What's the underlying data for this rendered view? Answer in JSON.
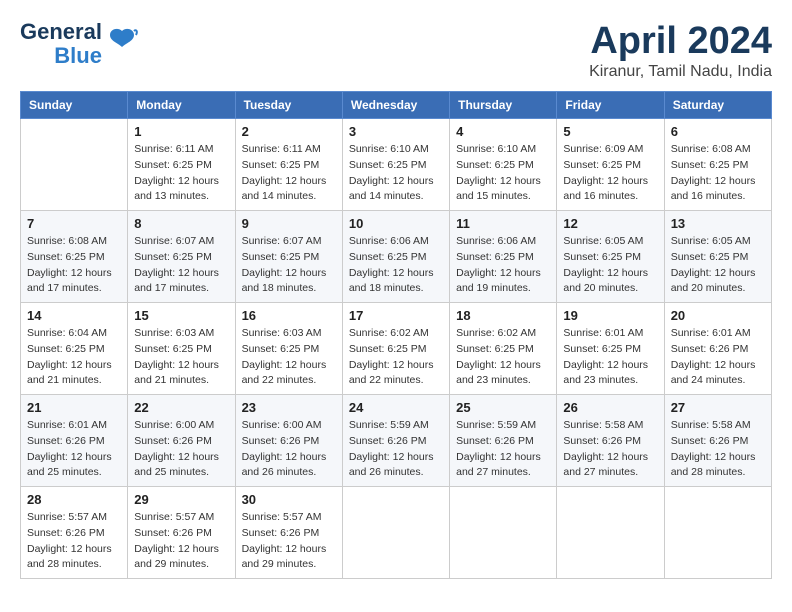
{
  "logo": {
    "line1": "General",
    "line2": "Blue"
  },
  "header": {
    "month": "April 2024",
    "location": "Kiranur, Tamil Nadu, India"
  },
  "weekdays": [
    "Sunday",
    "Monday",
    "Tuesday",
    "Wednesday",
    "Thursday",
    "Friday",
    "Saturday"
  ],
  "weeks": [
    [
      {
        "day": "",
        "info": ""
      },
      {
        "day": "1",
        "info": "Sunrise: 6:11 AM\nSunset: 6:25 PM\nDaylight: 12 hours\nand 13 minutes."
      },
      {
        "day": "2",
        "info": "Sunrise: 6:11 AM\nSunset: 6:25 PM\nDaylight: 12 hours\nand 14 minutes."
      },
      {
        "day": "3",
        "info": "Sunrise: 6:10 AM\nSunset: 6:25 PM\nDaylight: 12 hours\nand 14 minutes."
      },
      {
        "day": "4",
        "info": "Sunrise: 6:10 AM\nSunset: 6:25 PM\nDaylight: 12 hours\nand 15 minutes."
      },
      {
        "day": "5",
        "info": "Sunrise: 6:09 AM\nSunset: 6:25 PM\nDaylight: 12 hours\nand 16 minutes."
      },
      {
        "day": "6",
        "info": "Sunrise: 6:08 AM\nSunset: 6:25 PM\nDaylight: 12 hours\nand 16 minutes."
      }
    ],
    [
      {
        "day": "7",
        "info": "Sunrise: 6:08 AM\nSunset: 6:25 PM\nDaylight: 12 hours\nand 17 minutes."
      },
      {
        "day": "8",
        "info": "Sunrise: 6:07 AM\nSunset: 6:25 PM\nDaylight: 12 hours\nand 17 minutes."
      },
      {
        "day": "9",
        "info": "Sunrise: 6:07 AM\nSunset: 6:25 PM\nDaylight: 12 hours\nand 18 minutes."
      },
      {
        "day": "10",
        "info": "Sunrise: 6:06 AM\nSunset: 6:25 PM\nDaylight: 12 hours\nand 18 minutes."
      },
      {
        "day": "11",
        "info": "Sunrise: 6:06 AM\nSunset: 6:25 PM\nDaylight: 12 hours\nand 19 minutes."
      },
      {
        "day": "12",
        "info": "Sunrise: 6:05 AM\nSunset: 6:25 PM\nDaylight: 12 hours\nand 20 minutes."
      },
      {
        "day": "13",
        "info": "Sunrise: 6:05 AM\nSunset: 6:25 PM\nDaylight: 12 hours\nand 20 minutes."
      }
    ],
    [
      {
        "day": "14",
        "info": "Sunrise: 6:04 AM\nSunset: 6:25 PM\nDaylight: 12 hours\nand 21 minutes."
      },
      {
        "day": "15",
        "info": "Sunrise: 6:03 AM\nSunset: 6:25 PM\nDaylight: 12 hours\nand 21 minutes."
      },
      {
        "day": "16",
        "info": "Sunrise: 6:03 AM\nSunset: 6:25 PM\nDaylight: 12 hours\nand 22 minutes."
      },
      {
        "day": "17",
        "info": "Sunrise: 6:02 AM\nSunset: 6:25 PM\nDaylight: 12 hours\nand 22 minutes."
      },
      {
        "day": "18",
        "info": "Sunrise: 6:02 AM\nSunset: 6:25 PM\nDaylight: 12 hours\nand 23 minutes."
      },
      {
        "day": "19",
        "info": "Sunrise: 6:01 AM\nSunset: 6:25 PM\nDaylight: 12 hours\nand 23 minutes."
      },
      {
        "day": "20",
        "info": "Sunrise: 6:01 AM\nSunset: 6:26 PM\nDaylight: 12 hours\nand 24 minutes."
      }
    ],
    [
      {
        "day": "21",
        "info": "Sunrise: 6:01 AM\nSunset: 6:26 PM\nDaylight: 12 hours\nand 25 minutes."
      },
      {
        "day": "22",
        "info": "Sunrise: 6:00 AM\nSunset: 6:26 PM\nDaylight: 12 hours\nand 25 minutes."
      },
      {
        "day": "23",
        "info": "Sunrise: 6:00 AM\nSunset: 6:26 PM\nDaylight: 12 hours\nand 26 minutes."
      },
      {
        "day": "24",
        "info": "Sunrise: 5:59 AM\nSunset: 6:26 PM\nDaylight: 12 hours\nand 26 minutes."
      },
      {
        "day": "25",
        "info": "Sunrise: 5:59 AM\nSunset: 6:26 PM\nDaylight: 12 hours\nand 27 minutes."
      },
      {
        "day": "26",
        "info": "Sunrise: 5:58 AM\nSunset: 6:26 PM\nDaylight: 12 hours\nand 27 minutes."
      },
      {
        "day": "27",
        "info": "Sunrise: 5:58 AM\nSunset: 6:26 PM\nDaylight: 12 hours\nand 28 minutes."
      }
    ],
    [
      {
        "day": "28",
        "info": "Sunrise: 5:57 AM\nSunset: 6:26 PM\nDaylight: 12 hours\nand 28 minutes."
      },
      {
        "day": "29",
        "info": "Sunrise: 5:57 AM\nSunset: 6:26 PM\nDaylight: 12 hours\nand 29 minutes."
      },
      {
        "day": "30",
        "info": "Sunrise: 5:57 AM\nSunset: 6:26 PM\nDaylight: 12 hours\nand 29 minutes."
      },
      {
        "day": "",
        "info": ""
      },
      {
        "day": "",
        "info": ""
      },
      {
        "day": "",
        "info": ""
      },
      {
        "day": "",
        "info": ""
      }
    ]
  ]
}
